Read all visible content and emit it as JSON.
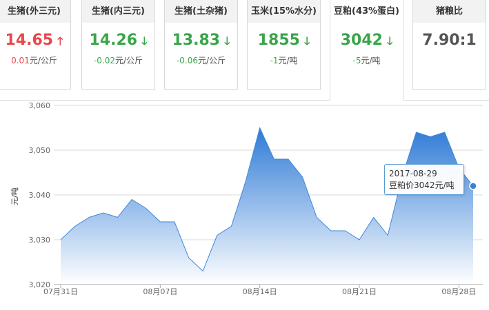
{
  "cards": [
    {
      "title": "生猪(外三元)",
      "price": "14.65",
      "trend": "up",
      "arrow": "🡑",
      "change_value": "0.01",
      "change_unit": "元/公斤"
    },
    {
      "title": "生猪(内三元)",
      "price": "14.26",
      "trend": "down",
      "arrow": "🡓",
      "change_value": "-0.02",
      "change_unit": "元/公斤"
    },
    {
      "title": "生猪(土杂猪)",
      "price": "13.83",
      "trend": "down",
      "arrow": "🡓",
      "change_value": "-0.06",
      "change_unit": "元/公斤"
    },
    {
      "title": "玉米(15%水分)",
      "price": "1855",
      "trend": "down",
      "arrow": "🡓",
      "change_value": "-1",
      "change_unit": "元/吨"
    },
    {
      "title": "豆粕(43%蛋白)",
      "price": "3042",
      "trend": "down",
      "arrow": "🡓",
      "change_value": "-5",
      "change_unit": "元/吨"
    },
    {
      "title": "猪粮比",
      "price": "7.90:1",
      "trend": "neutral",
      "arrow": "",
      "change_value": "",
      "change_unit": ""
    }
  ],
  "active_card": "豆粕(43%蛋白)",
  "colors": {
    "up": "#e8474c",
    "down": "#3aa54a",
    "area_top": "#2f7bd6",
    "area_bottom": "#ffffff",
    "line": "#3f86d9"
  },
  "tooltip": {
    "date": "2017-08-29",
    "series_label": "豆粕价",
    "value": "3042",
    "unit": "元/吨"
  },
  "chart_data": {
    "type": "area",
    "ylabel": "元/吨",
    "ylim": [
      3020,
      3060
    ],
    "yticks": [
      "3,020",
      "3,030",
      "3,040",
      "3,050",
      "3,060"
    ],
    "xticks": [
      "07月31日",
      "08月07日",
      "08月14日",
      "08月21日",
      "08月28日"
    ],
    "grid": true,
    "series": [
      {
        "x": [
          "07-31",
          "08-01",
          "08-02",
          "08-03",
          "08-04",
          "08-05",
          "08-06",
          "08-07",
          "08-08",
          "08-09",
          "08-10",
          "08-11",
          "08-12",
          "08-13",
          "08-14",
          "08-15",
          "08-16",
          "08-17",
          "08-18",
          "08-19",
          "08-20",
          "08-21",
          "08-22",
          "08-23",
          "08-24",
          "08-25",
          "08-26",
          "08-27",
          "08-28",
          "08-29"
        ],
        "values": [
          3030,
          3033,
          3035,
          3036,
          3035,
          3039,
          3037,
          3034,
          3034,
          3026,
          3023,
          3031,
          3033,
          3043,
          3055,
          3048,
          3048,
          3044,
          3035,
          3032,
          3032,
          3030,
          3035,
          3031,
          3044,
          3054,
          3053,
          3054,
          3046,
          3042
        ]
      }
    ]
  }
}
